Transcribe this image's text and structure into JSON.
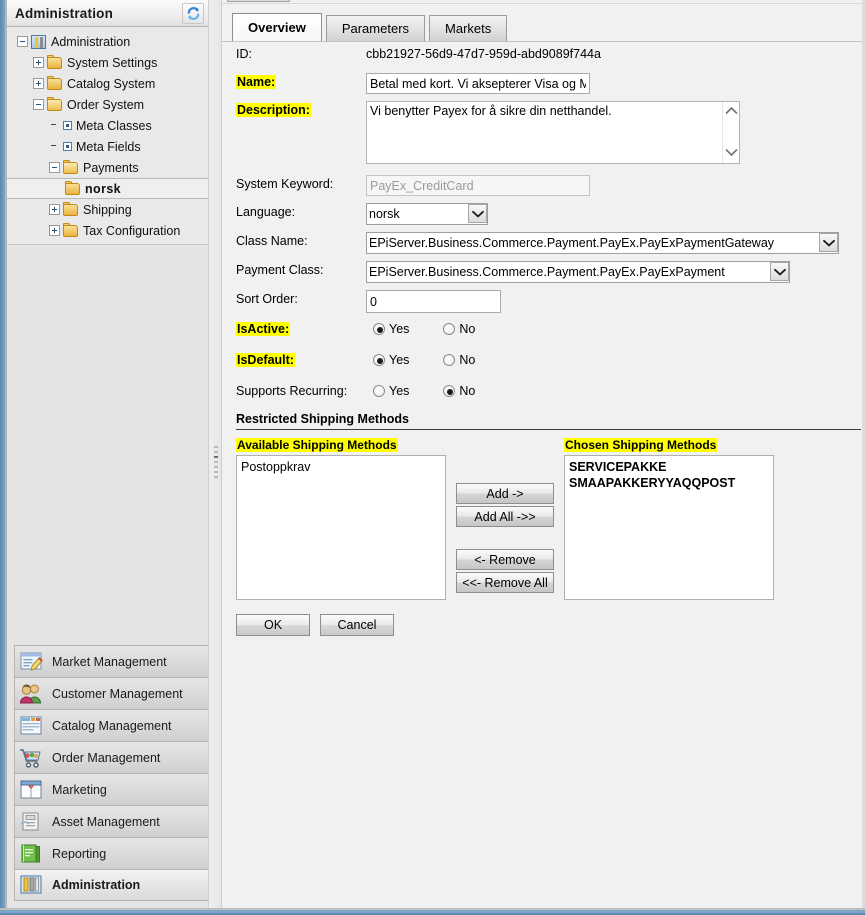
{
  "sidebar": {
    "header_title": "Administration",
    "refresh_icon": "refresh-icon",
    "tree": [
      {
        "label": "Administration",
        "level": 0,
        "icon": "administration-icon",
        "expander": "minus",
        "selected": false
      },
      {
        "label": "System Settings",
        "level": 1,
        "icon": "folder-closed-icon",
        "expander": "plus",
        "selected": false
      },
      {
        "label": "Catalog System",
        "level": 1,
        "icon": "folder-closed-icon",
        "expander": "plus",
        "selected": false
      },
      {
        "label": "Order System",
        "level": 1,
        "icon": "folder-open-icon",
        "expander": "minus",
        "selected": false
      },
      {
        "label": "Meta Classes",
        "level": 2,
        "icon": "leaf-node-icon",
        "expander": "none",
        "selected": false
      },
      {
        "label": "Meta Fields",
        "level": 2,
        "icon": "leaf-node-icon",
        "expander": "none",
        "selected": false
      },
      {
        "label": "Payments",
        "level": 2,
        "icon": "folder-open-icon",
        "expander": "minus",
        "selected": false
      },
      {
        "label": "norsk",
        "level": 3,
        "icon": "folder-closed-icon",
        "expander": "none",
        "selected": true
      },
      {
        "label": "Shipping",
        "level": 2,
        "icon": "folder-closed-icon",
        "expander": "plus",
        "selected": false
      },
      {
        "label": "Tax Configuration",
        "level": 2,
        "icon": "folder-closed-icon",
        "expander": "plus",
        "selected": false
      }
    ],
    "nav": [
      {
        "label": "Market Management",
        "icon": "market-management-icon",
        "active": false
      },
      {
        "label": "Customer Management",
        "icon": "customer-management-icon",
        "active": false
      },
      {
        "label": "Catalog Management",
        "icon": "catalog-management-icon",
        "active": false
      },
      {
        "label": "Order Management",
        "icon": "order-management-icon",
        "active": false
      },
      {
        "label": "Marketing",
        "icon": "marketing-icon",
        "active": false
      },
      {
        "label": "Asset Management",
        "icon": "asset-management-icon",
        "active": false
      },
      {
        "label": "Reporting",
        "icon": "reporting-icon",
        "active": false
      },
      {
        "label": "Administration",
        "icon": "administration-nav-icon",
        "active": true
      }
    ]
  },
  "main": {
    "tabs": [
      {
        "label": "Overview",
        "active": true
      },
      {
        "label": "Parameters",
        "active": false
      },
      {
        "label": "Markets",
        "active": false
      }
    ],
    "fields": {
      "id_label": "ID:",
      "id_value": "cbb21927-56d9-47d7-959d-abd9089f744a",
      "name_label": "Name:",
      "name_value": "Betal med kort. Vi aksepterer Visa og M",
      "description_label": "Description:",
      "description_value": "Vi benytter Payex for å sikre din netthandel.",
      "system_keyword_label": "System Keyword:",
      "system_keyword_value": "PayEx_CreditCard",
      "language_label": "Language:",
      "language_value": "norsk",
      "class_name_label": "Class Name:",
      "class_name_value": "EPiServer.Business.Commerce.Payment.PayEx.PayExPaymentGateway",
      "payment_class_label": "Payment Class:",
      "payment_class_value": "EPiServer.Business.Commerce.Payment.PayEx.PayExPayment",
      "sort_order_label": "Sort Order:",
      "sort_order_value": "0",
      "isactive_label": "IsActive:",
      "isactive_value": "Yes",
      "isdefault_label": "IsDefault:",
      "isdefault_value": "Yes",
      "supports_recurring_label": "Supports Recurring:",
      "supports_recurring_value": "No",
      "yes_label": "Yes",
      "no_label": "No"
    },
    "restricted": {
      "section_title": "Restricted Shipping Methods",
      "available_label": "Available Shipping Methods",
      "chosen_label": "Chosen Shipping Methods",
      "available_items": [
        "Postoppkrav"
      ],
      "chosen_items": [
        "SERVICEPAKKE",
        "SMAAPAKKERYYAQQPOST"
      ],
      "buttons": {
        "add": "Add ->",
        "add_all": "Add All ->>",
        "remove": "<- Remove",
        "remove_all": "<<- Remove All"
      }
    },
    "footer": {
      "ok": "OK",
      "cancel": "Cancel"
    }
  },
  "colors": {
    "highlight": "#ffff00",
    "frame_blue": "#5b89ae",
    "panel_gray": "#e4e4e4"
  }
}
